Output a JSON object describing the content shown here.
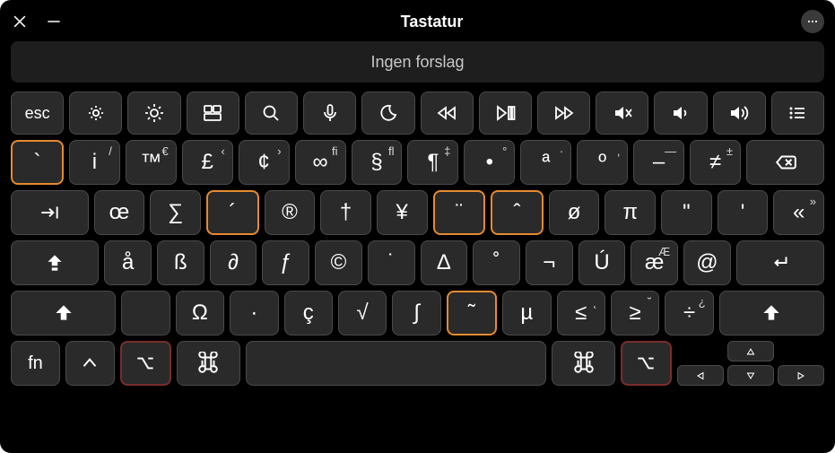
{
  "titlebar": {
    "title": "Tastatur"
  },
  "suggestion": "Ingen forslag",
  "fnRow": {
    "esc": "esc"
  },
  "row1": [
    {
      "main": "`",
      "up": "",
      "hl": "orange"
    },
    {
      "main": "i",
      "up": "/"
    },
    {
      "main": "™",
      "up": "€"
    },
    {
      "main": "£",
      "up": "‹"
    },
    {
      "main": "¢",
      "up": "›"
    },
    {
      "main": "∞",
      "up": "fi"
    },
    {
      "main": "§",
      "up": "fl"
    },
    {
      "main": "¶",
      "up": "‡"
    },
    {
      "main": "•",
      "up": "°"
    },
    {
      "main": "ª",
      "up": "·"
    },
    {
      "main": "º",
      "up": "‚"
    },
    {
      "main": "–",
      "up": "—"
    },
    {
      "main": "≠",
      "up": "±"
    }
  ],
  "row2": [
    {
      "main": "œ",
      "up": ""
    },
    {
      "main": "∑",
      "up": ""
    },
    {
      "main": "´",
      "up": "",
      "hl": "orange"
    },
    {
      "main": "®",
      "up": ""
    },
    {
      "main": "†",
      "up": ""
    },
    {
      "main": "¥",
      "up": ""
    },
    {
      "main": "¨",
      "up": "",
      "hl": "orange"
    },
    {
      "main": "ˆ",
      "up": "",
      "hl": "orange"
    },
    {
      "main": "ø",
      "up": ""
    },
    {
      "main": "π",
      "up": ""
    },
    {
      "main": "\"",
      "up": ""
    },
    {
      "main": "'",
      "up": ""
    },
    {
      "main": "«",
      "up": "»"
    }
  ],
  "row3": [
    {
      "main": "å",
      "up": ""
    },
    {
      "main": "ß",
      "up": ""
    },
    {
      "main": "∂",
      "up": ""
    },
    {
      "main": "ƒ",
      "up": ""
    },
    {
      "main": "©",
      "up": ""
    },
    {
      "main": "˙",
      "up": ""
    },
    {
      "main": "∆",
      "up": ""
    },
    {
      "main": "˚",
      "up": ""
    },
    {
      "main": "¬",
      "up": ""
    },
    {
      "main": "Ú",
      "up": ""
    },
    {
      "main": "æ",
      "up": "Æ"
    },
    {
      "main": "@",
      "up": ""
    }
  ],
  "row4": [
    {
      "main": "Ω",
      "up": ""
    },
    {
      "main": "∙",
      "up": ""
    },
    {
      "main": "ç",
      "up": ""
    },
    {
      "main": "√",
      "up": ""
    },
    {
      "main": "∫",
      "up": ""
    },
    {
      "main": "˜",
      "up": "",
      "hl": "orange"
    },
    {
      "main": "µ",
      "up": ""
    },
    {
      "main": "≤",
      "up": "˛"
    },
    {
      "main": "≥",
      "up": "˘"
    },
    {
      "main": "÷",
      "up": "¿"
    }
  ],
  "row5": {
    "fn": "fn"
  }
}
